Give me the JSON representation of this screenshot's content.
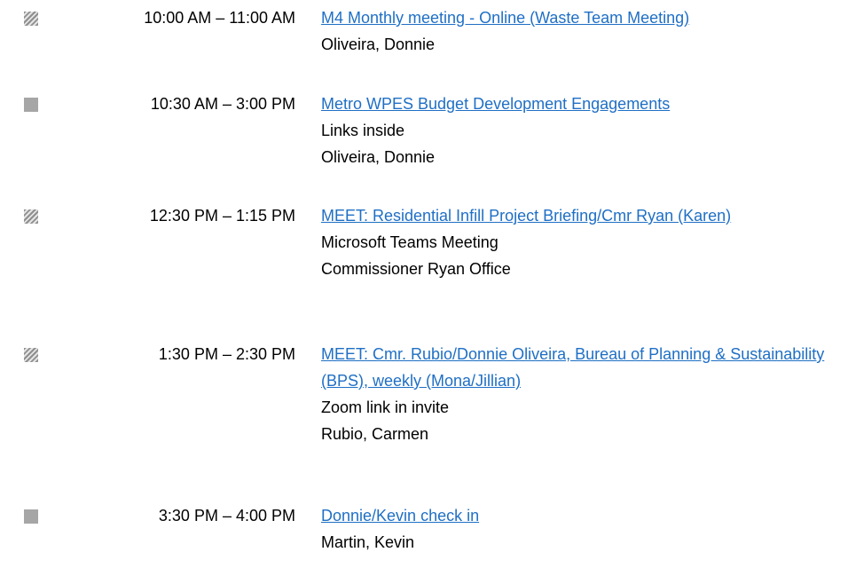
{
  "events": [
    {
      "status": "tentative",
      "time": "10:00 AM – 11:00 AM",
      "title": "M4 Monthly meeting - Online (Waste Team Meeting)",
      "lines": [
        "Oliveira, Donnie"
      ]
    },
    {
      "status": "busy",
      "time": "10:30 AM – 3:00 PM",
      "title": "Metro WPES Budget Development Engagements",
      "lines": [
        "Links inside",
        "Oliveira, Donnie"
      ]
    },
    {
      "status": "tentative",
      "time": "12:30 PM – 1:15 PM",
      "title": "MEET: Residential Infill Project Briefing/Cmr Ryan (Karen)",
      "lines": [
        "Microsoft Teams Meeting",
        "Commissioner Ryan Office"
      ]
    },
    {
      "status": "tentative",
      "time": "1:30 PM – 2:30 PM",
      "title": "MEET: Cmr. Rubio/Donnie Oliveira, Bureau of Planning & Sustainability (BPS), weekly (Mona/Jillian)",
      "lines": [
        "Zoom link in invite",
        "Rubio, Carmen"
      ]
    },
    {
      "status": "busy",
      "time": "3:30 PM – 4:00 PM",
      "title": "Donnie/Kevin check in",
      "lines": [
        "Martin, Kevin"
      ]
    }
  ]
}
